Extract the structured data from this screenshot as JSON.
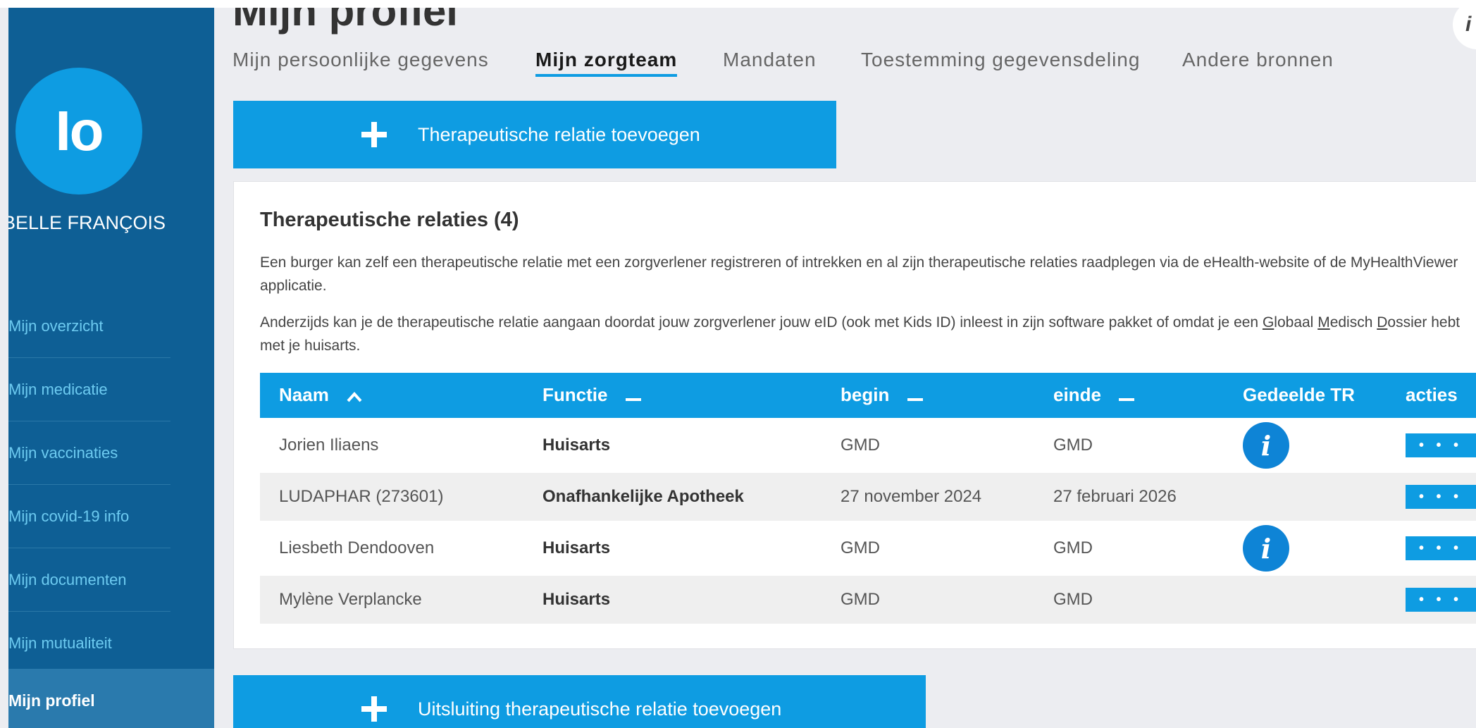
{
  "page": {
    "title": "Mijn profiel",
    "corner_glyph": "i"
  },
  "sidebar": {
    "avatar_initials": "Io",
    "user_name": "BELLE FRANÇOIS",
    "items": [
      {
        "label": "Mijn overzicht"
      },
      {
        "label": "Mijn medicatie"
      },
      {
        "label": "Mijn vaccinaties"
      },
      {
        "label": "Mijn covid-19 info"
      },
      {
        "label": "Mijn documenten"
      },
      {
        "label": "Mijn mutualiteit"
      }
    ],
    "active_item": "Mijn profiel"
  },
  "tabs": [
    {
      "label": "Mijn persoonlijke gegevens"
    },
    {
      "label": "Mijn zorgteam"
    },
    {
      "label": "Mandaten"
    },
    {
      "label": "Toestemming gegevensdeling"
    },
    {
      "label": "Andere bronnen"
    }
  ],
  "add_button": {
    "label": "Therapeutische relatie toevoegen",
    "icon": "plus-icon"
  },
  "exclude_button": {
    "label": "Uitsluiting therapeutische relatie toevoegen",
    "icon": "plus-icon"
  },
  "card": {
    "title": "Therapeutische relaties (4)",
    "para1": "Een burger kan zelf een therapeutische relatie met een zorgverlener registreren of intrekken en al zijn therapeutische relaties raadplegen via de eHealth-website of de MyHealthViewer applicatie.",
    "para2_a": "Anderzijds kan je de therapeutische relatie aangaan doordat jouw zorgverlener jouw eID (ook met Kids ID) inleest in zijn software pakket of omdat je een ",
    "para2_g": "G",
    "para2_b": "lobaal ",
    "para2_m": "M",
    "para2_c": "edisch ",
    "para2_d": "D",
    "para2_e": "ossier hebt met je huisarts."
  },
  "table": {
    "headers": {
      "naam": "Naam",
      "functie": "Functie",
      "begin": "begin",
      "einde": "einde",
      "gedeelde": "Gedeelde TR",
      "acties": "acties"
    },
    "rows": [
      {
        "naam": "Jorien Iliaens",
        "functie": "Huisarts",
        "begin": "GMD",
        "einde": "GMD",
        "info": "i"
      },
      {
        "naam": "LUDAPHAR (273601)",
        "functie": "Onafhankelijke Apotheek",
        "begin": "27 november 2024",
        "einde": "27 februari 2026",
        "info": ""
      },
      {
        "naam": "Liesbeth Dendooven",
        "functie": "Huisarts",
        "begin": "GMD",
        "einde": "GMD",
        "info": "i"
      },
      {
        "naam": "Mylène Verplancke",
        "functie": "Huisarts",
        "begin": "GMD",
        "einde": "GMD",
        "info": ""
      }
    ],
    "actions_glyph": "• • •"
  },
  "colors": {
    "primary": "#0e9ce2",
    "sidebar": "#0e5f95",
    "sidebar_active": "#2a7aad",
    "sidebar_link": "#6dcbf1"
  }
}
